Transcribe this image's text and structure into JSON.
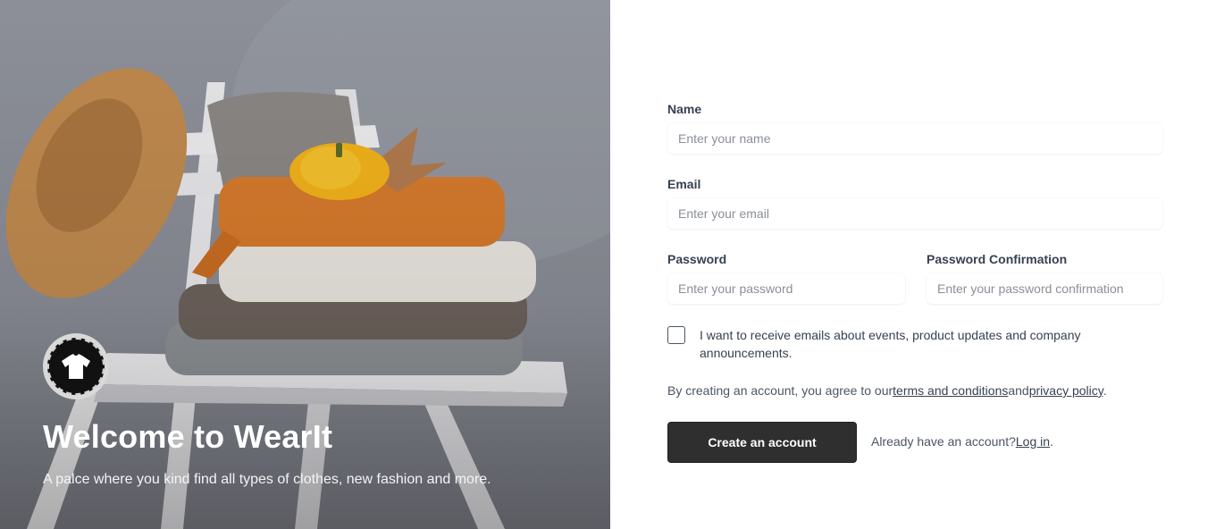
{
  "hero": {
    "title": "Welcome to WearIt",
    "subtitle": "A palce where you kind find all types of clothes, new fashion and more.",
    "logo_icon": "t-shirt-logo-icon"
  },
  "form": {
    "name": {
      "label": "Name",
      "placeholder": "Enter your name"
    },
    "email": {
      "label": "Email",
      "placeholder": "Enter your email"
    },
    "password": {
      "label": "Password",
      "placeholder": "Enter your password"
    },
    "password_confirmation": {
      "label": "Password Confirmation",
      "placeholder": "Enter your password confirmation"
    },
    "marketing_opt_in": {
      "checked": false,
      "label": "I want to receive emails about events, product updates and company announcements."
    },
    "terms": {
      "prefix": "By creating an account, you agree to our",
      "terms_link": "terms and conditions",
      "and": "and",
      "privacy_link": "privacy policy",
      "suffix": "."
    },
    "submit_label": "Create an account",
    "login": {
      "prefix": "Already have an account?",
      "link": "Log in",
      "suffix": "."
    }
  },
  "colors": {
    "button_bg": "#2f2f2f",
    "button_text": "#ffffff",
    "hero_text": "#ffffff",
    "label_text": "#374151"
  }
}
